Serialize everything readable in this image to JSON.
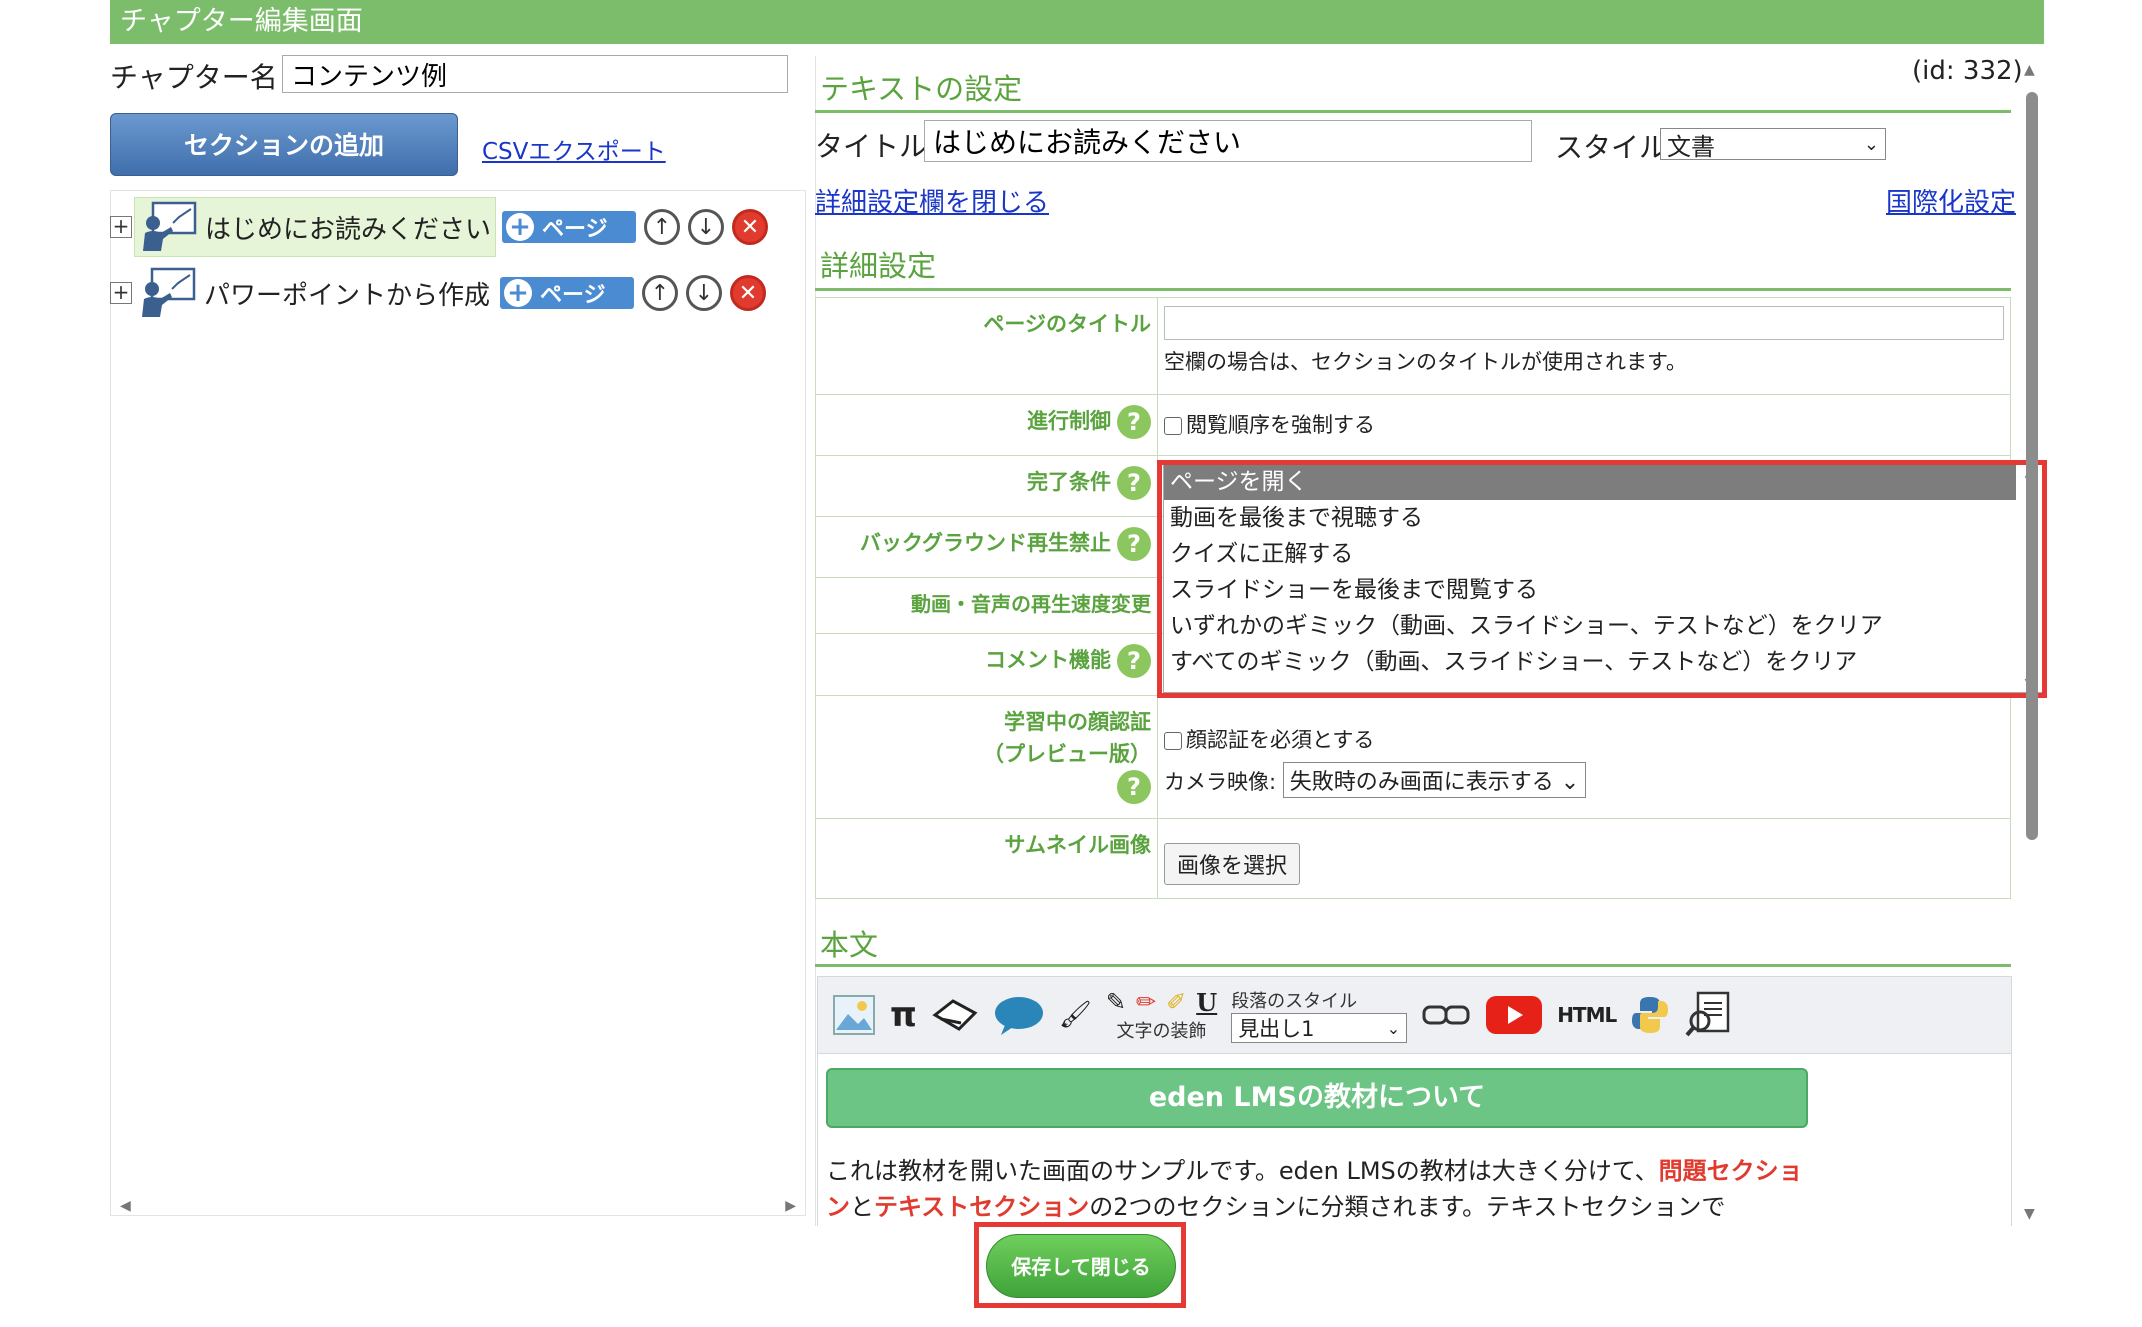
{
  "header": {
    "title": "チャプター編集画面"
  },
  "chapter": {
    "name_label": "チャプター名：",
    "name_value": "コンテンツ例"
  },
  "left": {
    "add_section_label": "セクションの追加",
    "csv_export_label": "CSVエクスポート",
    "sections": [
      {
        "title": "はじめにお読みください",
        "page_button": "ページ"
      },
      {
        "title": "パワーポイントから作成",
        "page_button": "ページ"
      }
    ]
  },
  "text_settings": {
    "heading": "テキストの設定",
    "id_label": "(id: 332)",
    "title_label": "タイトル:",
    "title_value": "はじめにお読みください",
    "style_label": "スタイル:",
    "style_value": "文書",
    "close_details_link": "詳細設定欄を閉じる",
    "i18n_link": "国際化設定"
  },
  "detail": {
    "heading": "詳細設定",
    "page_title_label": "ページのタイトル",
    "page_title_hint": "空欄の場合は、セクションのタイトルが使用されます。",
    "progress_label": "進行制御",
    "progress_checkbox": "閲覧順序を強制する",
    "completion_label": "完了条件",
    "completion_options": [
      "ページを開く",
      "動画を最後まで視聴する",
      "クイズに正解する",
      "スライドショーを最後まで閲覧する",
      "いずれかのギミック（動画、スライドショー、テストなど）をクリア",
      "すべてのギミック（動画、スライドショー、テストなど）をクリア"
    ],
    "background_label": "バックグラウンド再生禁止",
    "speed_label": "動画・音声の再生速度変更",
    "comment_label": "コメント機能",
    "face_label_1": "学習中の顔認証",
    "face_label_2": "（プレビュー版）",
    "face_checkbox": "顔認証を必須とする",
    "camera_label": "カメラ映像:",
    "camera_value": "失敗時のみ画面に表示する",
    "thumbnail_label": "サムネイル画像",
    "thumbnail_button": "画像を選択",
    "help_glyph": "?"
  },
  "body": {
    "heading": "本文",
    "toolbar": {
      "paragraph_style_label": "段落のスタイル",
      "paragraph_style_value": "見出し1",
      "text_decoration_label": "文字の装飾",
      "html_label": "HTML",
      "pi_glyph": "π",
      "underline_glyph": "U"
    },
    "heading_box": "eden LMSの教材について",
    "paragraph": {
      "part1": "これは教材を開いた画面のサンプルです。eden LMSの教材は大きく分けて、",
      "red1": "問題セクション",
      "part2": "と",
      "red2": "テキストセクション",
      "part3": "の2つのセクションに分類されます。テキストセクションで"
    }
  },
  "footer": {
    "save_close_label": "保存して閉じる"
  },
  "colors": {
    "header_green": "#7cbd6c",
    "title_green": "#5aa33f",
    "link_blue": "#1a36c8",
    "highlight_red": "#e53935",
    "button_blue": "#4a8bd1"
  }
}
